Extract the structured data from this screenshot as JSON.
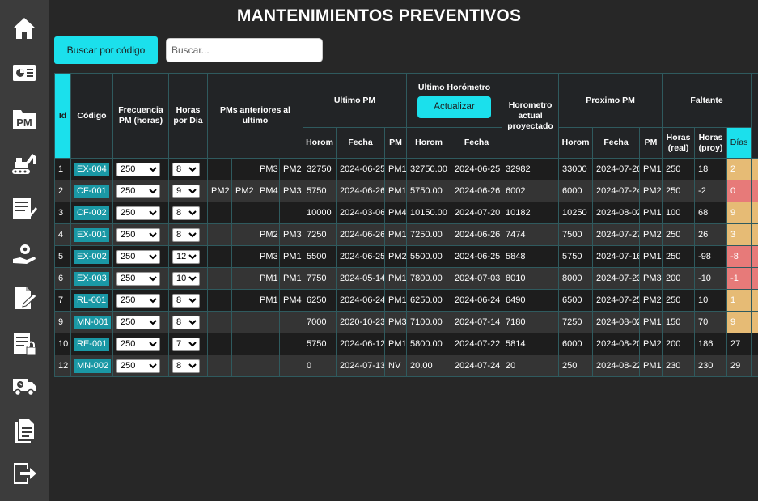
{
  "title": "MANTENIMIENTOS PREVENTIVOS",
  "search": {
    "button_label": "Buscar por código",
    "placeholder": "Buscar..."
  },
  "sidebar": {
    "items": [
      {
        "icon": "home-icon"
      },
      {
        "icon": "dashboard-icon"
      },
      {
        "icon": "pm-folder-icon",
        "text": "PM"
      },
      {
        "icon": "excavator-icon"
      },
      {
        "icon": "list-edit-icon"
      },
      {
        "icon": "service-gear-icon"
      },
      {
        "icon": "document-edit-icon"
      },
      {
        "icon": "clipboard-lock-icon"
      },
      {
        "icon": "delivery-truck-icon"
      },
      {
        "icon": "documents-icon"
      },
      {
        "icon": "logout-icon"
      }
    ]
  },
  "table": {
    "headers": {
      "id": "Id",
      "codigo": "Código",
      "frecuencia": "Frecuencia PM (horas)",
      "horas_dia": "Horas por Dia",
      "pms_anteriores": "PMs anteriores al ultimo",
      "ultimo_pm": "Ultimo PM",
      "ultimo_horometro": "Ultimo Horómetro",
      "actualizar": "Actualizar",
      "horometro_actual": "Horometro actual proyectado",
      "proximo_pm": "Proximo PM",
      "faltante": "Faltante",
      "horom": "Horom",
      "fecha": "Fecha",
      "pm": "PM",
      "horas_real": "Horas (real)",
      "horas_proy": "Horas (proy)",
      "dias": "Días"
    },
    "rows": [
      {
        "id": "1",
        "code": "EX-004",
        "freq": "250",
        "hpd": "8",
        "prev": [
          "",
          "",
          "PM3",
          "PM2"
        ],
        "u_horom": "32750",
        "u_fecha": "2024-06-25",
        "u_pm": "PM1",
        "uh_horom": "32750.00",
        "uh_fecha": "2024-06-25",
        "actual": "32982",
        "p_horom": "33000",
        "p_fecha": "2024-07-26",
        "p_pm": "PM1",
        "f_real": "250",
        "f_proy": "18",
        "dias": "2",
        "dias_status": "orange"
      },
      {
        "id": "2",
        "code": "CF-001",
        "freq": "250",
        "hpd": "9",
        "prev": [
          "PM2",
          "PM2",
          "PM4",
          "PM3"
        ],
        "u_horom": "5750",
        "u_fecha": "2024-06-26",
        "u_pm": "PM1",
        "uh_horom": "5750.00",
        "uh_fecha": "2024-06-26",
        "actual": "6002",
        "p_horom": "6000",
        "p_fecha": "2024-07-24",
        "p_pm": "PM2",
        "f_real": "250",
        "f_proy": "-2",
        "dias": "0",
        "dias_status": "red"
      },
      {
        "id": "3",
        "code": "CF-002",
        "freq": "250",
        "hpd": "8",
        "prev": [
          "",
          "",
          "",
          ""
        ],
        "u_horom": "10000",
        "u_fecha": "2024-03-06",
        "u_pm": "PM4",
        "uh_horom": "10150.00",
        "uh_fecha": "2024-07-20",
        "actual": "10182",
        "p_horom": "10250",
        "p_fecha": "2024-08-02",
        "p_pm": "PM1",
        "f_real": "100",
        "f_proy": "68",
        "dias": "9",
        "dias_status": "orange"
      },
      {
        "id": "4",
        "code": "EX-001",
        "freq": "250",
        "hpd": "8",
        "prev": [
          "",
          "",
          "PM2",
          "PM3"
        ],
        "u_horom": "7250",
        "u_fecha": "2024-06-26",
        "u_pm": "PM1",
        "uh_horom": "7250.00",
        "uh_fecha": "2024-06-26",
        "actual": "7474",
        "p_horom": "7500",
        "p_fecha": "2024-07-27",
        "p_pm": "PM2",
        "f_real": "250",
        "f_proy": "26",
        "dias": "3",
        "dias_status": "orange"
      },
      {
        "id": "5",
        "code": "EX-002",
        "freq": "250",
        "hpd": "12",
        "prev": [
          "",
          "",
          "PM3",
          "PM1"
        ],
        "u_horom": "5500",
        "u_fecha": "2024-06-25",
        "u_pm": "PM2",
        "uh_horom": "5500.00",
        "uh_fecha": "2024-06-25",
        "actual": "5848",
        "p_horom": "5750",
        "p_fecha": "2024-07-16",
        "p_pm": "PM1",
        "f_real": "250",
        "f_proy": "-98",
        "dias": "-8",
        "dias_status": "red"
      },
      {
        "id": "6",
        "code": "EX-003",
        "freq": "250",
        "hpd": "10",
        "prev": [
          "",
          "",
          "PM1",
          "PM1"
        ],
        "u_horom": "7750",
        "u_fecha": "2024-05-14",
        "u_pm": "PM1",
        "uh_horom": "7800.00",
        "uh_fecha": "2024-07-03",
        "actual": "8010",
        "p_horom": "8000",
        "p_fecha": "2024-07-23",
        "p_pm": "PM3",
        "f_real": "200",
        "f_proy": "-10",
        "dias": "-1",
        "dias_status": "red"
      },
      {
        "id": "7",
        "code": "RL-001",
        "freq": "250",
        "hpd": "8",
        "prev": [
          "",
          "",
          "PM1",
          "PM4"
        ],
        "u_horom": "6250",
        "u_fecha": "2024-06-24",
        "u_pm": "PM1",
        "uh_horom": "6250.00",
        "uh_fecha": "2024-06-24",
        "actual": "6490",
        "p_horom": "6500",
        "p_fecha": "2024-07-25",
        "p_pm": "PM2",
        "f_real": "250",
        "f_proy": "10",
        "dias": "1",
        "dias_status": "orange"
      },
      {
        "id": "9",
        "code": "MN-001",
        "freq": "250",
        "hpd": "8",
        "prev": [
          "",
          "",
          "",
          ""
        ],
        "u_horom": "7000",
        "u_fecha": "2020-10-23",
        "u_pm": "PM3",
        "uh_horom": "7100.00",
        "uh_fecha": "2024-07-14",
        "actual": "7180",
        "p_horom": "7250",
        "p_fecha": "2024-08-02",
        "p_pm": "PM1",
        "f_real": "150",
        "f_proy": "70",
        "dias": "9",
        "dias_status": "orange"
      },
      {
        "id": "10",
        "code": "RE-001",
        "freq": "250",
        "hpd": "7",
        "prev": [
          "",
          "",
          "",
          ""
        ],
        "u_horom": "5750",
        "u_fecha": "2024-06-12",
        "u_pm": "PM1",
        "uh_horom": "5800.00",
        "uh_fecha": "2024-07-22",
        "actual": "5814",
        "p_horom": "6000",
        "p_fecha": "2024-08-20",
        "p_pm": "PM2",
        "f_real": "200",
        "f_proy": "186",
        "dias": "27",
        "dias_status": "none"
      },
      {
        "id": "12",
        "code": "MN-002",
        "freq": "250",
        "hpd": "8",
        "prev": [
          "",
          "",
          "",
          ""
        ],
        "u_horom": "0",
        "u_fecha": "2024-07-13",
        "u_pm": "NV",
        "uh_horom": "20.00",
        "uh_fecha": "2024-07-24",
        "actual": "20",
        "p_horom": "250",
        "p_fecha": "2024-08-22",
        "p_pm": "PM1",
        "f_real": "230",
        "f_proy": "230",
        "dias": "29",
        "dias_status": "none"
      }
    ]
  }
}
